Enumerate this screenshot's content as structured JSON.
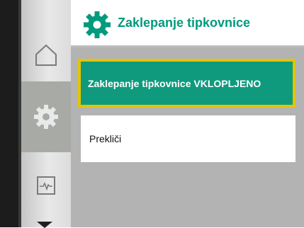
{
  "header": {
    "title": "Zaklepanje tipkovnice",
    "icon": "settings-gear-icon"
  },
  "sidebar": {
    "items": [
      {
        "icon": "home-icon",
        "state": "default"
      },
      {
        "icon": "settings-gear-icon",
        "state": "active"
      },
      {
        "icon": "diagnostics-monitor-icon",
        "state": "default"
      }
    ],
    "scroll_indicator": "chevron-down-icon"
  },
  "menu": {
    "options": [
      {
        "label": "Zaklepanje tipkovnice VKLOPLJENO",
        "selected": true
      },
      {
        "label": "Prekliči",
        "selected": false
      }
    ]
  },
  "colors": {
    "accent": "#009a7e",
    "focus": "#e3c400",
    "panel": "#b3b3b3",
    "active_sidebar": "#a7aaa5"
  }
}
